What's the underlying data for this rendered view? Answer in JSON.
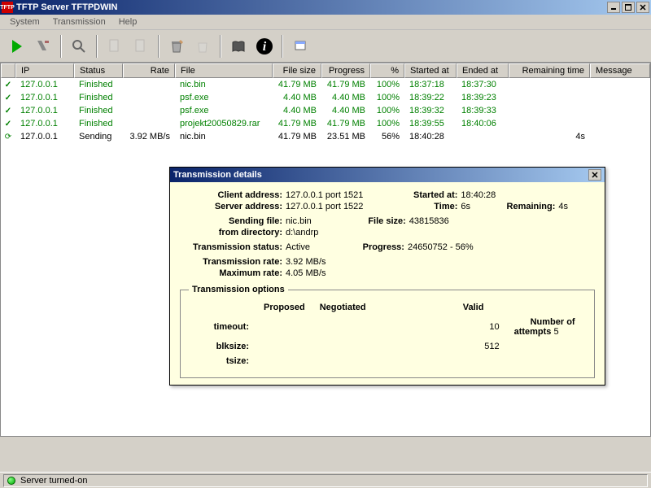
{
  "window": {
    "title": "TFTP Server TFTPDWIN",
    "app_badge": "TFTP"
  },
  "menu": {
    "system": "System",
    "transmission": "Transmission",
    "help": "Help"
  },
  "columns": {
    "ip": "IP",
    "status": "Status",
    "rate": "Rate",
    "file": "File",
    "filesize": "File size",
    "progress": "Progress",
    "percent": "%",
    "started": "Started at",
    "ended": "Ended at",
    "remaining": "Remaining time",
    "message": "Message"
  },
  "rows": [
    {
      "status_class": "finished",
      "ip": "127.0.0.1",
      "status": "Finished",
      "rate": "",
      "file": "nic.bin",
      "filesize": "41.79 MB",
      "progress": "41.79 MB",
      "percent": "100%",
      "started": "18:37:18",
      "ended": "18:37:30",
      "remaining": "",
      "message": ""
    },
    {
      "status_class": "finished",
      "ip": "127.0.0.1",
      "status": "Finished",
      "rate": "",
      "file": "psf.exe",
      "filesize": "4.40 MB",
      "progress": "4.40 MB",
      "percent": "100%",
      "started": "18:39:22",
      "ended": "18:39:23",
      "remaining": "",
      "message": ""
    },
    {
      "status_class": "finished",
      "ip": "127.0.0.1",
      "status": "Finished",
      "rate": "",
      "file": "psf.exe",
      "filesize": "4.40 MB",
      "progress": "4.40 MB",
      "percent": "100%",
      "started": "18:39:32",
      "ended": "18:39:33",
      "remaining": "",
      "message": ""
    },
    {
      "status_class": "finished",
      "ip": "127.0.0.1",
      "status": "Finished",
      "rate": "",
      "file": "projekt20050829.rar",
      "filesize": "41.79 MB",
      "progress": "41.79 MB",
      "percent": "100%",
      "started": "18:39:55",
      "ended": "18:40:06",
      "remaining": "",
      "message": ""
    },
    {
      "status_class": "sending",
      "ip": "127.0.0.1",
      "status": "Sending",
      "rate": "3.92 MB/s",
      "file": "nic.bin",
      "filesize": "41.79 MB",
      "progress": "23.51 MB",
      "percent": "56%",
      "started": "18:40:28",
      "ended": "",
      "remaining": "4s",
      "message": ""
    }
  ],
  "details": {
    "title": "Transmission details",
    "labels": {
      "client_address": "Client address:",
      "server_address": "Server address:",
      "sending_file": "Sending file:",
      "from_directory": "from directory:",
      "transmission_status": "Transmission status:",
      "transmission_rate": "Transmission rate:",
      "maximum_rate": "Maximum rate:",
      "started_at": "Started at:",
      "time": "Time:",
      "remaining": "Remaining:",
      "file_size": "File size:",
      "progress": "Progress:",
      "options_legend": "Transmission options",
      "proposed": "Proposed",
      "negotiated": "Negotiated",
      "valid": "Valid",
      "timeout": "timeout:",
      "blksize": "blksize:",
      "tsize": "tsize:",
      "num_attempts": "Number of attempts"
    },
    "values": {
      "client_address": "127.0.0.1 port 1521",
      "server_address": "127.0.0.1 port 1522",
      "sending_file": "nic.bin",
      "from_directory": "d:\\andrp",
      "transmission_status": "Active",
      "transmission_rate": "3.92 MB/s",
      "maximum_rate": "4.05 MB/s",
      "started_at": "18:40:28",
      "time": "6s",
      "remaining": "4s",
      "file_size": "43815836",
      "progress": "24650752 - 56%",
      "timeout_valid": "10",
      "blksize_valid": "512",
      "num_attempts": "5"
    }
  },
  "statusbar": {
    "text": "Server turned-on"
  }
}
